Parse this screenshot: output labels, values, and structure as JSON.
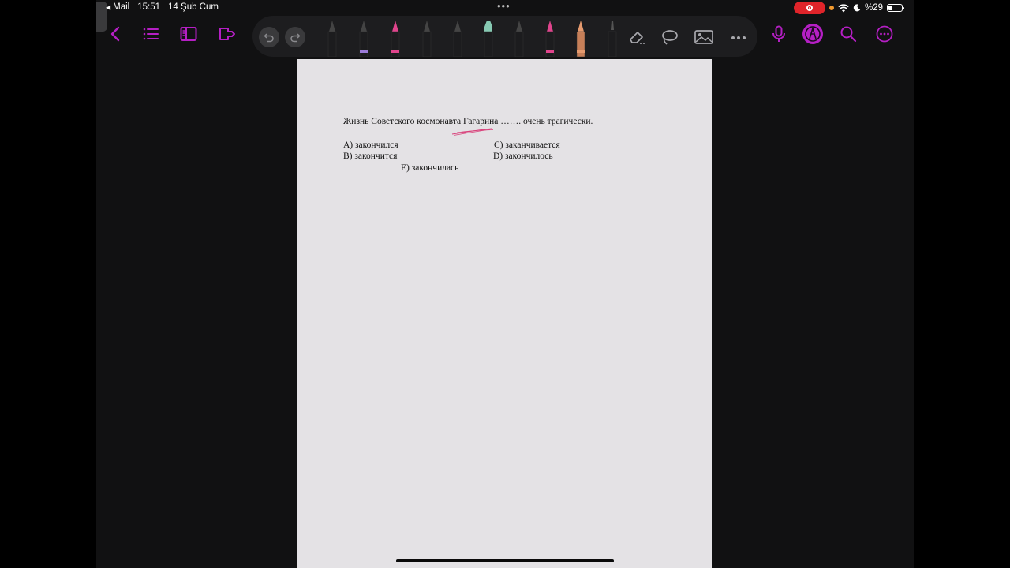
{
  "status_bar": {
    "back_app": "Mail",
    "time": "15:51",
    "date": "14 Şub Cum",
    "battery": "%29",
    "battery_level": 0.29
  },
  "toolbar": {
    "left_icons": [
      "chevron-left-icon",
      "list-icon",
      "sidebar-icon",
      "export-icon"
    ],
    "tray_buttons": [
      "undo-icon",
      "redo-icon"
    ],
    "tools": [
      {
        "name": "fountain-pen",
        "color": "#2b2b2e"
      },
      {
        "name": "fountain-pen-purple",
        "color": "#9b7bd8"
      },
      {
        "name": "ballpoint-pink",
        "color": "#e0448c"
      },
      {
        "name": "brush-pen",
        "color": "#2b2b2e"
      },
      {
        "name": "fineliner",
        "color": "#2b2b2e"
      },
      {
        "name": "highlighter-mint",
        "color": "#86c9b2"
      },
      {
        "name": "marker-black",
        "color": "#2b2b2e"
      },
      {
        "name": "pencil-pink",
        "color": "#e0448c"
      },
      {
        "name": "pencil-orange",
        "color": "#e59a6e"
      },
      {
        "name": "calligraphy-pen",
        "color": "#2b2b2e"
      }
    ],
    "tray_right_icons": [
      "eraser-icon",
      "lasso-icon",
      "image-icon",
      "more-icon"
    ],
    "right_icons": [
      "microphone-icon",
      "pencil-mode-icon",
      "search-icon",
      "more-circle-icon"
    ],
    "accent": "#b51fc4"
  },
  "document": {
    "question": "Жизнь Советского космонавта Гагарина ……. очень трагически.",
    "options": {
      "a": "A) закончился",
      "b": "B) закончится",
      "c": "C) заканчивается",
      "d": "D) закончилось",
      "e": "E) закончилась"
    },
    "annotation_color": "#d9407a"
  }
}
